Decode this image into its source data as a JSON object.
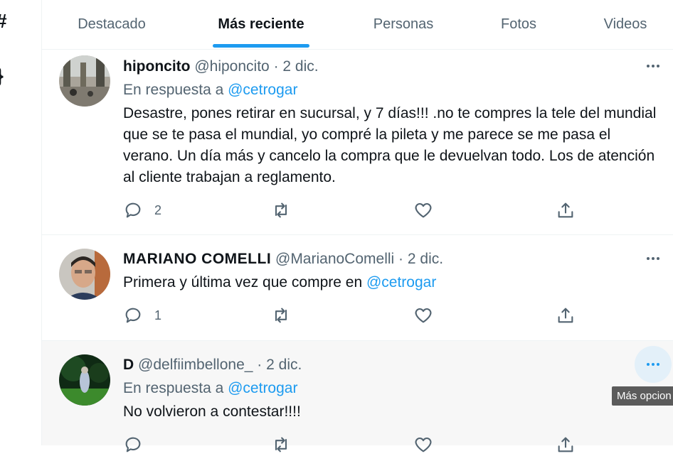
{
  "tabs": [
    {
      "label": "Destacado"
    },
    {
      "label": "Más reciente",
      "active": true
    },
    {
      "label": "Personas"
    },
    {
      "label": "Fotos"
    },
    {
      "label": "Videos"
    }
  ],
  "tweets": [
    {
      "name": "hiponcito",
      "handle": "@hiponcito",
      "separator": "·",
      "date": "2 dic.",
      "reply_prefix": "En respuesta a",
      "reply_mention": "@cetrogar",
      "text": "Desastre, pones retirar en sucursal, y 7 días!!! .no te compres la tele del mundial que se te pasa el mundial, yo compré la pileta y me parece se me pasa el verano. Un día más y cancelo la compra que le devuelvan todo. Los de atención al cliente trabajan a reglamento.",
      "reply_count": "2"
    },
    {
      "name": "MARIANO COMELLI",
      "handle": "@MarianoComelli",
      "separator": "·",
      "date": "2 dic.",
      "text_prefix": "Primera y última vez que compre en ",
      "text_mention": "@cetrogar",
      "reply_count": "1"
    },
    {
      "name": "D",
      "handle": "@delfiimbellone_",
      "separator": "·",
      "date": "2 dic.",
      "reply_prefix": "En respuesta a",
      "reply_mention": "@cetrogar",
      "text": "No volvieron a contestar!!!!"
    }
  ],
  "tooltip": "Más opcion",
  "icons": {
    "more": "more-icon",
    "reply": "reply-icon",
    "retweet": "retweet-icon",
    "like": "like-icon",
    "share": "share-icon"
  },
  "colors": {
    "accent": "#1d9bf0",
    "muted": "#536471",
    "text": "#0f1419"
  }
}
